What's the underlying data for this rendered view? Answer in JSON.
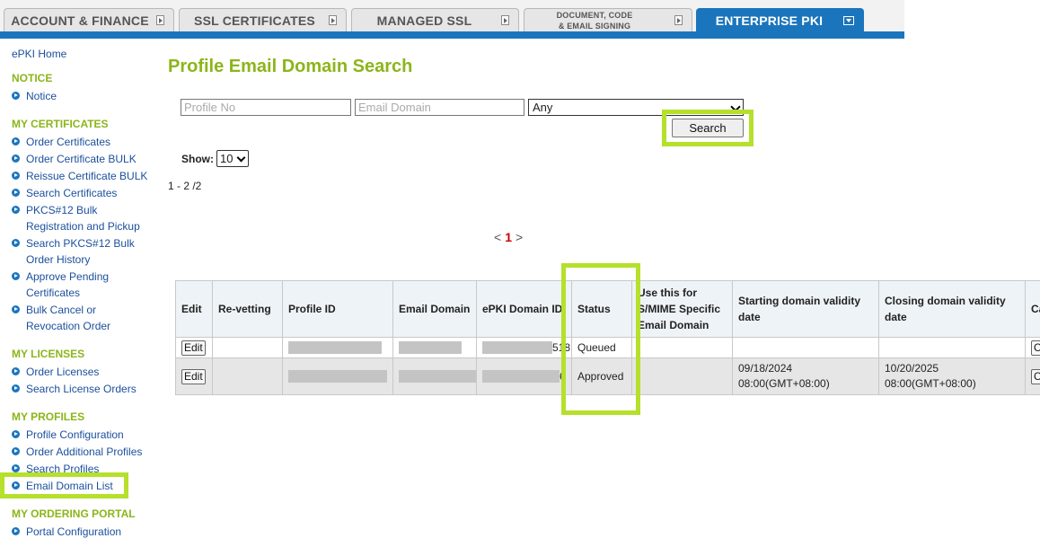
{
  "tabs": [
    {
      "label": "ACCOUNT & FINANCE",
      "active": false
    },
    {
      "label": "SSL CERTIFICATES",
      "active": false
    },
    {
      "label": "MANAGED SSL",
      "active": false
    },
    {
      "label_line1": "DOCUMENT, CODE",
      "label_line2": "& EMAIL SIGNING",
      "active": false
    },
    {
      "label": "ENTERPRISE PKI",
      "active": true
    }
  ],
  "sidebar": {
    "home": "ePKI Home",
    "sections": [
      {
        "title": "NOTICE",
        "items": [
          {
            "label": "Notice"
          }
        ]
      },
      {
        "title": "MY CERTIFICATES",
        "items": [
          {
            "label": "Order Certificates"
          },
          {
            "label": "Order Certificate BULK"
          },
          {
            "label": "Reissue Certificate BULK"
          },
          {
            "label": "Search Certificates"
          },
          {
            "label_line1": "PKCS#12 Bulk",
            "label_line2": "Registration and Pickup"
          },
          {
            "label_line1": "Search PKCS#12 Bulk",
            "label_line2": "Order History"
          },
          {
            "label_line1": "Approve Pending",
            "label_line2": "Certificates"
          },
          {
            "label_line1": "Bulk Cancel or",
            "label_line2": "Revocation Order"
          }
        ]
      },
      {
        "title": "MY LICENSES",
        "items": [
          {
            "label": "Order Licenses"
          },
          {
            "label": "Search License Orders"
          }
        ]
      },
      {
        "title": "MY PROFILES",
        "items": [
          {
            "label": "Profile Configuration"
          },
          {
            "label": "Order Additional Profiles"
          },
          {
            "label": "Search Profiles"
          },
          {
            "label": "Email Domain List",
            "highlighted": true
          }
        ]
      },
      {
        "title": "MY ORDERING PORTAL",
        "items": [
          {
            "label": "Portal Configuration"
          }
        ]
      }
    ]
  },
  "main": {
    "title": "Profile Email Domain Search",
    "search": {
      "profile_no_placeholder": "Profile No",
      "email_domain_placeholder": "Email Domain",
      "status_selected": "Any",
      "button_label": "Search"
    },
    "show_label": "Show:",
    "show_value": "10",
    "range": "1 - 2 /2",
    "pager": {
      "prev": "<",
      "current": "1",
      "next": ">"
    },
    "table": {
      "headers": [
        "Edit",
        "Re-vetting",
        "Profile ID",
        "Email Domain",
        "ePKI Domain ID",
        "Status",
        "Use this for S/MIME Specific Email Domain",
        "Starting domain validity date",
        "Closing domain validity date",
        "Ca"
      ],
      "rows": [
        {
          "edit": "Edit",
          "domain_id_tail": "518",
          "status": "Queued",
          "start": "",
          "close": "",
          "cancel": "C"
        },
        {
          "edit": "Edit",
          "domain_id_tail": "6",
          "status": "Approved",
          "start_date": "09/18/2024",
          "start_time": "08:00(GMT+08:00)",
          "close_date": "10/20/2025",
          "close_time": "08:00(GMT+08:00)",
          "cancel": "C"
        }
      ]
    }
  },
  "colors": {
    "accent": "#8cb51a",
    "nav_blue": "#1b75bc",
    "highlight": "#b5e02b",
    "link": "#1b4f9c"
  }
}
